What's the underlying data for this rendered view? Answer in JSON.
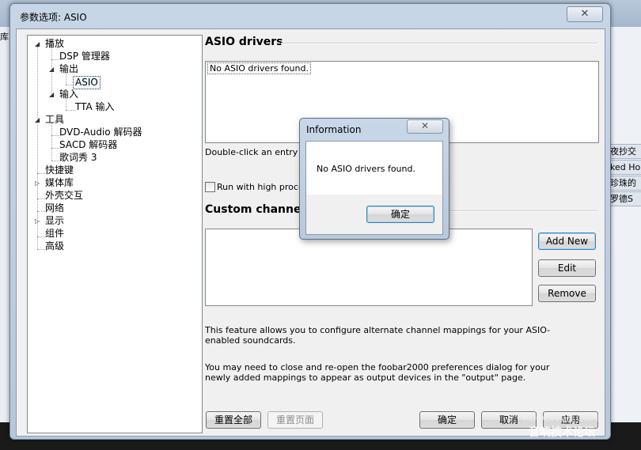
{
  "background": {
    "left_stub": "库",
    "right_items": [
      "夜抄交",
      "ked Hor",
      "珍珠的",
      "罗德S"
    ],
    "watermark_top": "HDOCRAIN.COM",
    "watermark_bottom": "音响技术论坛"
  },
  "window": {
    "title": "参数选项: ASIO",
    "close_glyph": "✕"
  },
  "tree": {
    "items": [
      {
        "label": "播放",
        "toggle": "◢"
      },
      {
        "label": "DSP 管理器"
      },
      {
        "label": "输出",
        "toggle": "◢"
      },
      {
        "label": "ASIO"
      },
      {
        "label": "输入",
        "toggle": "◢"
      },
      {
        "label": "TTA 输入"
      },
      {
        "label": "工具",
        "toggle": "◢"
      },
      {
        "label": "DVD-Audio 解码器"
      },
      {
        "label": "SACD 解码器"
      },
      {
        "label": "歌词秀 3"
      },
      {
        "label": "快捷键"
      },
      {
        "label": "媒体库",
        "toggle": "▷"
      },
      {
        "label": "外壳交互"
      },
      {
        "label": "网络"
      },
      {
        "label": "显示",
        "toggle": "▷"
      },
      {
        "label": "组件"
      },
      {
        "label": "高级"
      }
    ]
  },
  "asio": {
    "title": "ASIO drivers",
    "list_items": [
      "No ASIO drivers found."
    ],
    "hint": "Double-click an entry to a",
    "checkbox_label": "Run with high process",
    "checkbox_checked": false
  },
  "custom": {
    "title": "Custom channel m",
    "add_label": "Add New",
    "edit_label": "Edit",
    "remove_label": "Remove",
    "desc1": "This feature allows you to configure alternate channel mappings for your ASIO-enabled soundcards.",
    "desc2": "You may need to close and re-open the foobar2000 preferences dialog for your newly added mappings to appear as output devices in the \"output\" page."
  },
  "footer": {
    "reset_all": "重置全部",
    "reset_page": "重置页面",
    "ok": "确定",
    "cancel": "取消",
    "apply": "应用"
  },
  "dialog": {
    "title": "Information",
    "close_glyph": "✕",
    "message": "No ASIO drivers found.",
    "ok": "确定"
  }
}
